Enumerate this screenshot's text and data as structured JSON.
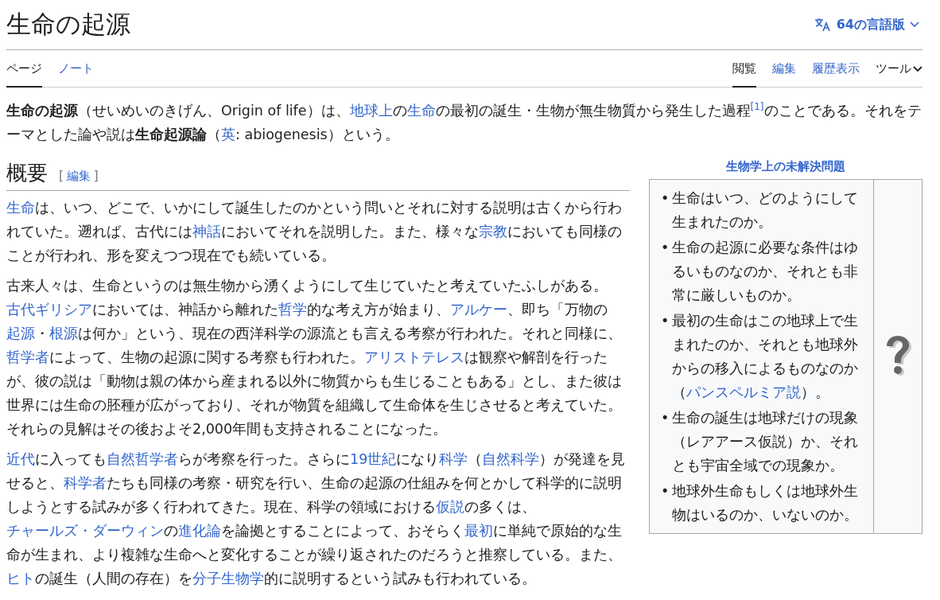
{
  "title": "生命の起源",
  "language_button": {
    "label": "64の言語版"
  },
  "tabs_left": [
    {
      "label": "ページ",
      "selected": true
    },
    {
      "label": "ノート",
      "selected": false
    }
  ],
  "tabs_right": [
    {
      "label": "閲覧",
      "selected": true,
      "kind": "tab"
    },
    {
      "label": "編集",
      "selected": false,
      "kind": "tab"
    },
    {
      "label": "履歴表示",
      "selected": false,
      "kind": "tab"
    },
    {
      "label": "ツール",
      "selected": false,
      "kind": "menu"
    }
  ],
  "lead": [
    {
      "kind": "bold",
      "text": "生命の起源"
    },
    {
      "kind": "text",
      "text": "（せいめいのきげん、Origin of life）は、"
    },
    {
      "kind": "link",
      "text": "地球上"
    },
    {
      "kind": "text",
      "text": "の"
    },
    {
      "kind": "link",
      "text": "生命"
    },
    {
      "kind": "text",
      "text": "の最初の誕生・生物が無生物質から発生した過程"
    },
    {
      "kind": "ref",
      "text": "[1]"
    },
    {
      "kind": "text",
      "text": "のことである。それをテーマとした論や説は"
    },
    {
      "kind": "bold",
      "text": "生命起源論"
    },
    {
      "kind": "text",
      "text": "（"
    },
    {
      "kind": "link",
      "text": "英"
    },
    {
      "kind": "text",
      "text": ": abiogenesis）という。"
    }
  ],
  "infobox": {
    "caption": "生物学上の未解決問題",
    "bullet": "•",
    "items": [
      [
        {
          "kind": "text",
          "text": "生命はいつ、どのようにして生まれたのか。"
        }
      ],
      [
        {
          "kind": "text",
          "text": "生命の起源に必要な条件はゆるいものなのか、それとも非常に厳しいものか。"
        }
      ],
      [
        {
          "kind": "text",
          "text": "最初の生命はこの地球上で生まれたのか、それとも地球外からの移入によるものなのか（"
        },
        {
          "kind": "link",
          "text": "パンスペルミア説"
        },
        {
          "kind": "text",
          "text": "）。"
        }
      ],
      [
        {
          "kind": "text",
          "text": "生命の誕生は地球だけの現象（レアアース仮説）か、それとも宇宙全域での現象か。"
        }
      ],
      [
        {
          "kind": "text",
          "text": "地球外生命もしくは地球外生物はいるのか、いないのか。"
        }
      ]
    ]
  },
  "section": {
    "heading": "概要",
    "edit_open": "[",
    "edit_link": "編集",
    "edit_close": "]",
    "paragraphs": [
      [
        {
          "kind": "link",
          "text": "生命"
        },
        {
          "kind": "text",
          "text": "は、いつ、どこで、いかにして誕生したのかという問いとそれに対する説明は古くから行われていた。遡れば、古代には"
        },
        {
          "kind": "link",
          "text": "神話"
        },
        {
          "kind": "text",
          "text": "においてそれを説明した。また、様々な"
        },
        {
          "kind": "link",
          "text": "宗教"
        },
        {
          "kind": "text",
          "text": "においても同様のことが行われ、形を変えつつ現在でも続いている。"
        }
      ],
      [
        {
          "kind": "text",
          "text": "古来人々は、生命というのは無生物から湧くようにして生じていたと考えていたふしがある。"
        },
        {
          "kind": "link",
          "text": "古代ギリシア"
        },
        {
          "kind": "text",
          "text": "においては、神話から離れた"
        },
        {
          "kind": "link",
          "text": "哲学"
        },
        {
          "kind": "text",
          "text": "的な考え方が始まり、"
        },
        {
          "kind": "link",
          "text": "アルケー"
        },
        {
          "kind": "text",
          "text": "、即ち「万物の"
        },
        {
          "kind": "link",
          "text": "起源"
        },
        {
          "kind": "text",
          "text": "・"
        },
        {
          "kind": "link",
          "text": "根源"
        },
        {
          "kind": "text",
          "text": "は何か」という、現在の西洋科学の源流とも言える考察が行われた。それと同様に、"
        },
        {
          "kind": "link",
          "text": "哲学者"
        },
        {
          "kind": "text",
          "text": "によって、生物の起源に関する考察も行われた。"
        },
        {
          "kind": "link",
          "text": "アリストテレス"
        },
        {
          "kind": "text",
          "text": "は観察や解剖を行ったが、彼の説は「動物は親の体から産まれる以外に物質からも生じることもある」とし、また彼は世界には生命の胚種が広がっており、それが物質を組織して生命体を生じさせると考えていた。それらの見解はその後およそ2,000年間も支持されることになった。"
        }
      ],
      [
        {
          "kind": "link",
          "text": "近代"
        },
        {
          "kind": "text",
          "text": "に入っても"
        },
        {
          "kind": "link",
          "text": "自然哲学者"
        },
        {
          "kind": "text",
          "text": "らが考察を行った。さらに"
        },
        {
          "kind": "link",
          "text": "19世紀"
        },
        {
          "kind": "text",
          "text": "になり"
        },
        {
          "kind": "link",
          "text": "科学"
        },
        {
          "kind": "text",
          "text": "（"
        },
        {
          "kind": "link",
          "text": "自然科学"
        },
        {
          "kind": "text",
          "text": "）が発達を見せると、"
        },
        {
          "kind": "link",
          "text": "科学者"
        },
        {
          "kind": "text",
          "text": "たちも同様の考察・研究を行い、生命の起源の仕組みを何とかして科学的に説明しようとする試みが多く行われてきた。現在、科学の領域における"
        },
        {
          "kind": "link",
          "text": "仮説"
        },
        {
          "kind": "text",
          "text": "の多くは、"
        },
        {
          "kind": "link",
          "text": "チャールズ・ダーウィン"
        },
        {
          "kind": "text",
          "text": "の"
        },
        {
          "kind": "link",
          "text": "進化論"
        },
        {
          "kind": "text",
          "text": "を論拠とすることによって、おそらく"
        },
        {
          "kind": "link",
          "text": "最初"
        },
        {
          "kind": "text",
          "text": "に単純で原始的な生命が生まれ、より複雑な生命へと変化することが繰り返されたのだろうと推察している。また、"
        },
        {
          "kind": "link",
          "text": "ヒト"
        },
        {
          "kind": "text",
          "text": "の誕生（人間の存在）を"
        },
        {
          "kind": "link",
          "text": "分子生物学"
        },
        {
          "kind": "text",
          "text": "的に説明するという試みも行われている。"
        }
      ]
    ]
  }
}
